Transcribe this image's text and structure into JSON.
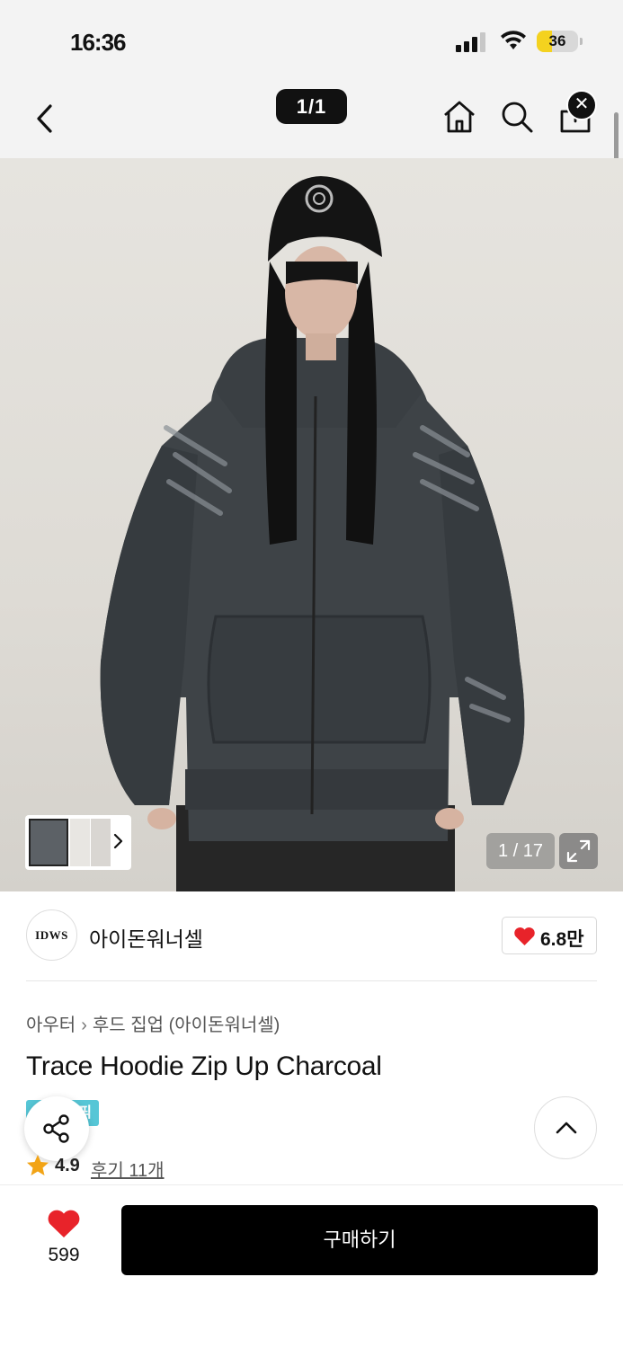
{
  "status_bar": {
    "time": "16:36",
    "battery_percent": "36",
    "battery_level": 0.36,
    "icons": [
      "cellular-signal-icon",
      "wifi-icon",
      "battery-icon"
    ]
  },
  "header": {
    "page_counter": "1/1",
    "icons": [
      "back-arrow-icon",
      "home-icon",
      "search-icon",
      "share-box-icon",
      "close-icon"
    ]
  },
  "gallery": {
    "image_counter": "1 / 17",
    "icons": [
      "chevron-right-icon",
      "expand-icon"
    ]
  },
  "brand": {
    "logo_text": "IDWS",
    "name": "아이돈워너셀",
    "likes": "6.8만"
  },
  "breadcrumb": {
    "items": [
      "아우터",
      "후드 집업 (아이돈워너셀)"
    ]
  },
  "product": {
    "title": "Trace Hoodie Zip Up Charcoal",
    "badge": "픽",
    "rating": "4.9",
    "reviews": "후기 11개"
  },
  "bottom_bar": {
    "wish_count": "599",
    "buy_label": "구매하기"
  },
  "colors": {
    "accent": "#e8232a",
    "buy_button": "#000000",
    "badge": "#56c6d6",
    "star": "#f2a416"
  }
}
